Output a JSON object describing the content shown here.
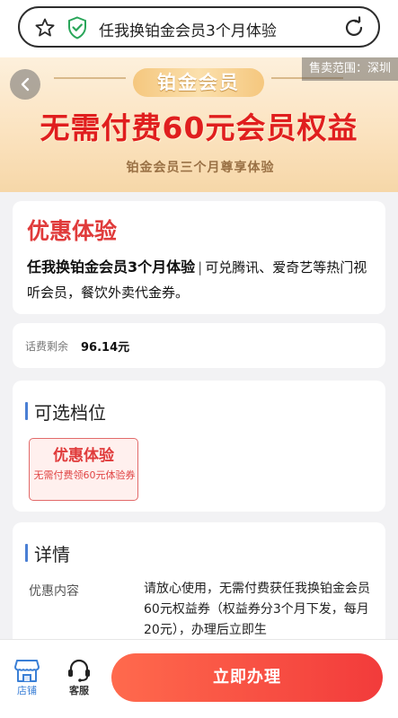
{
  "browser": {
    "page_title": "任我换铂金会员3个月体验"
  },
  "banner": {
    "tag": "铂金会员",
    "headline": "无需付费60元会员权益",
    "subline": "铂金会员三个月尊享体验",
    "region_label": "售卖范围：深圳"
  },
  "offer": {
    "title": "优惠体验",
    "product_name": "任我换铂金会员3个月体验",
    "separator": "|",
    "description": "可兑腾讯、爱奇艺等热门视听会员，餐饮外卖代金券。"
  },
  "balance": {
    "label": "话费剩余",
    "value": "96.14元"
  },
  "tiers": {
    "section_title": "可选档位",
    "options": [
      {
        "title": "优惠体验",
        "desc": "无需付费领60元体验券"
      }
    ]
  },
  "details": {
    "section_title": "详情",
    "key": "优惠内容",
    "value": "请放心使用，无需付费获任我换铂金会员60元权益券（权益券分3个月下发，每月20元），办理后立即生"
  },
  "bottom_bar": {
    "store_label": "店铺",
    "service_label": "客服",
    "apply_label": "立即办理"
  },
  "colors": {
    "accent_red": "#e03b3b",
    "button_gradient_start": "#ff6a4d",
    "button_gradient_end": "#f23b3b",
    "section_bar_blue": "#4a7fd4",
    "store_tab_blue": "#3a7fd6"
  }
}
